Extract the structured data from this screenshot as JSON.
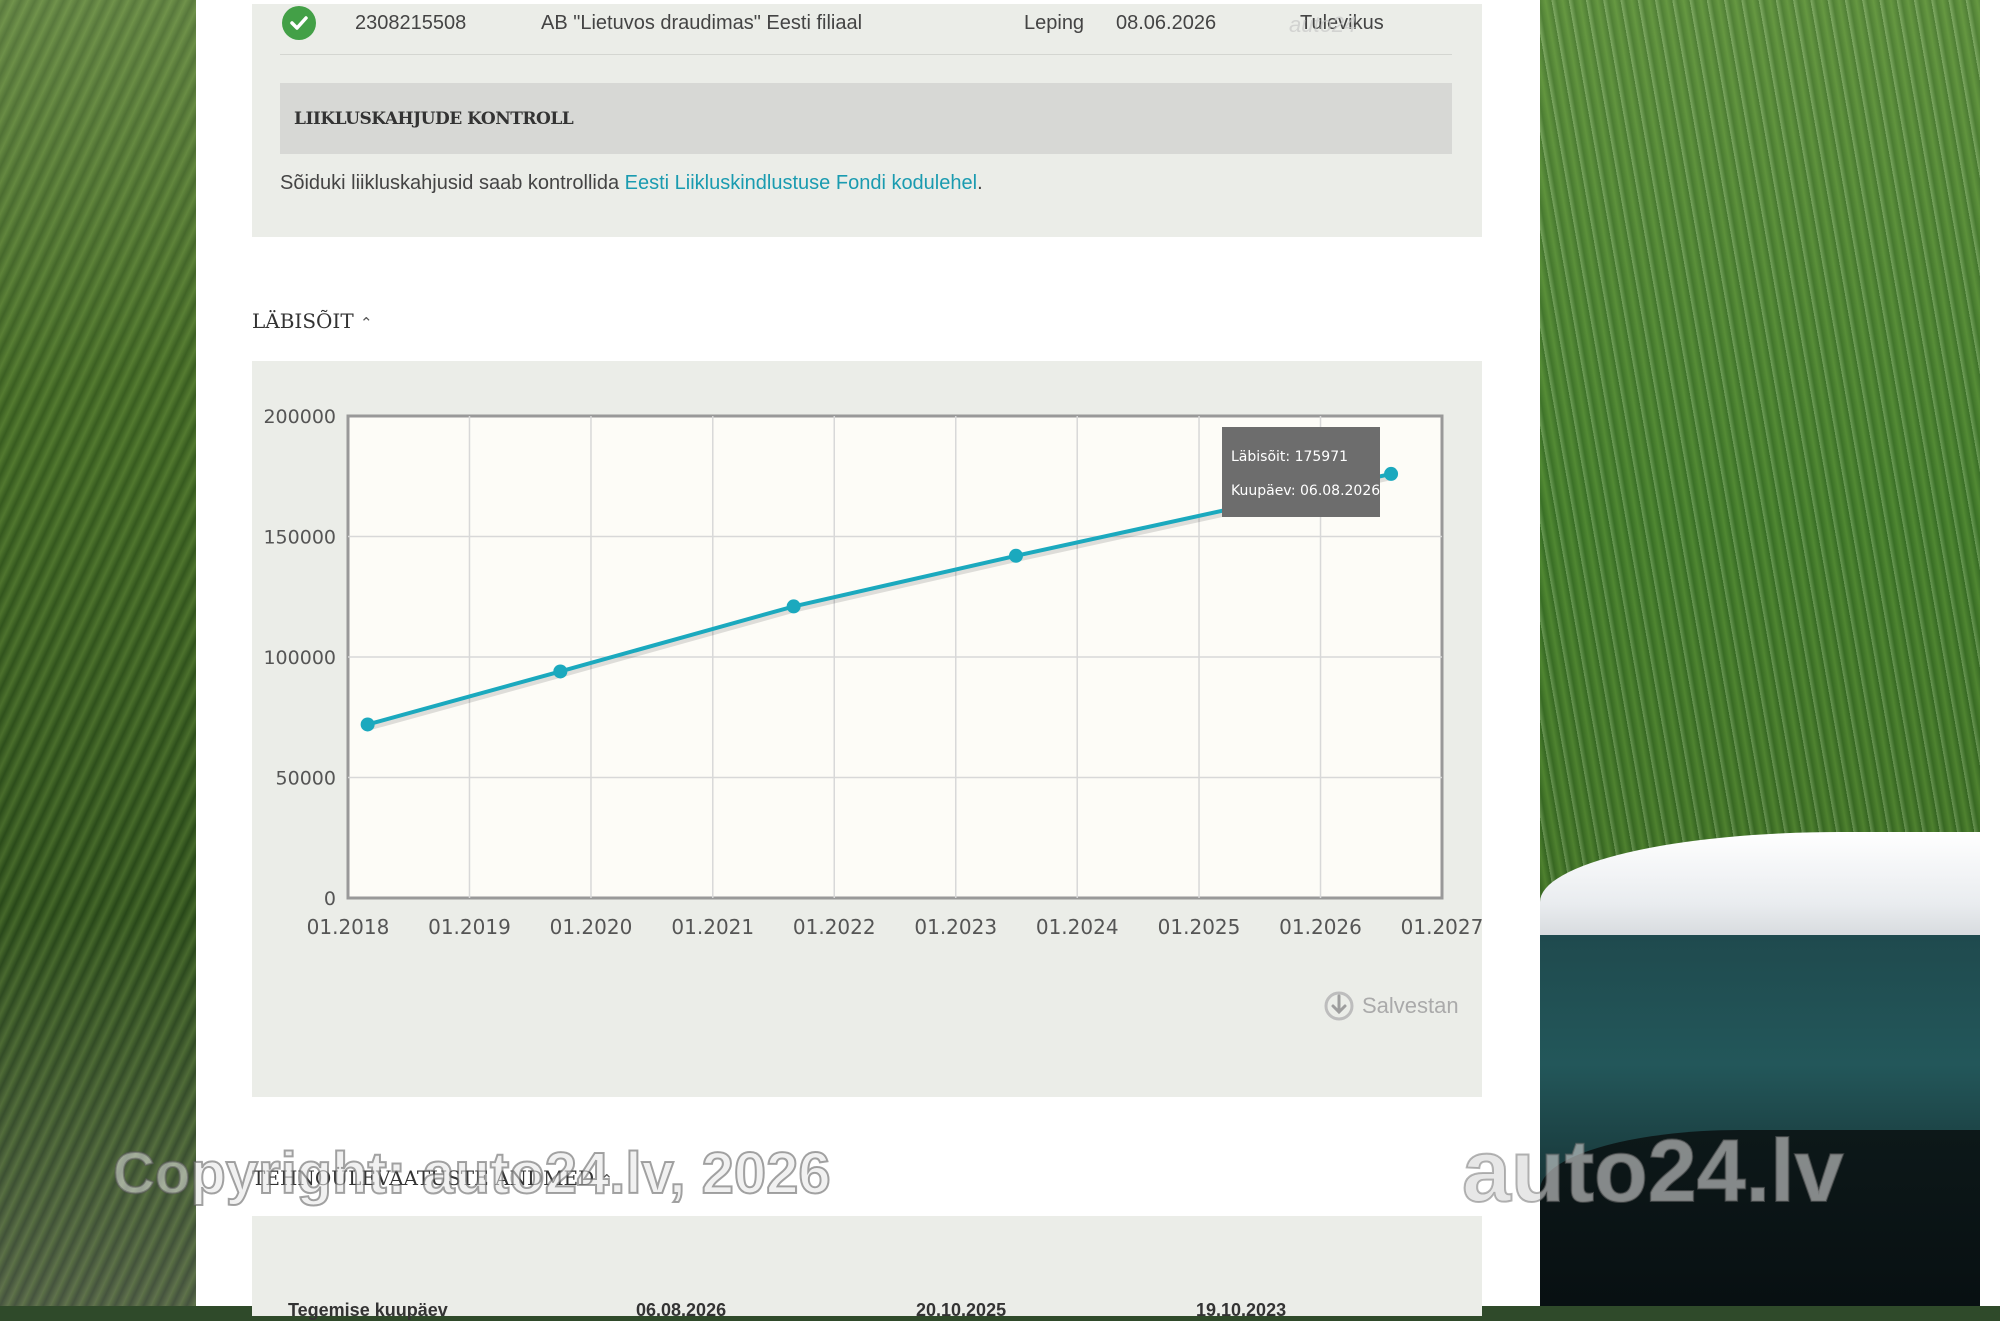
{
  "insurance_row": {
    "number": "2308215508",
    "insurer": "AB \"Lietuvos draudimas\" Eesti filiaal",
    "type": "Leping",
    "date": "08.06.2026",
    "status": "Tulevikus",
    "status_icon": "check-circle-icon"
  },
  "watermark_small": "auto24",
  "damage_check": {
    "title": "LIIKLUSKAHJUDE KONTROLL",
    "text_before": "Sõiduki liikluskahjusid saab kontrollida ",
    "link_text": "Eesti Liikluskindlustuse Fondi kodulehel",
    "text_after": "."
  },
  "mileage": {
    "title": "LÄBISÕIT",
    "toggle_icon": "chevron-double-up-icon",
    "tooltip_label_1": "Läbisõit: ",
    "tooltip_value_1": "175971",
    "tooltip_label_2": "Kuupäev: ",
    "tooltip_value_2": "06.08.2026",
    "save_label": "Salvestan",
    "save_icon": "download-icon"
  },
  "chart_data": {
    "type": "line",
    "x_tick_labels": [
      "01.2018",
      "01.2019",
      "01.2020",
      "01.2021",
      "01.2022",
      "01.2023",
      "01.2024",
      "01.2025",
      "01.2026",
      "01.2027"
    ],
    "y_tick_labels": [
      "0",
      "50000",
      "100000",
      "150000",
      "200000"
    ],
    "x": [
      "2018-03",
      "2019-10",
      "2021-09",
      "2023-07",
      "2026-08"
    ],
    "values": [
      72000,
      94000,
      121000,
      142000,
      175971
    ],
    "ylim": [
      0,
      200000
    ],
    "grid": true,
    "line_color": "#1ba9be",
    "plot_background": "#fdfcf7"
  },
  "tech": {
    "title": "TEHNOÜLEVAATUSTE ANDMED",
    "toggle_icon": "chevron-double-up-icon",
    "row_label": "Tegemise kuupäev",
    "dates": [
      "06.08.2026",
      "20.10.2025",
      "19.10.2023"
    ]
  },
  "watermarks": {
    "copyright": "Copyright: auto24.lv, 2026",
    "logo": "auto24.lv"
  }
}
